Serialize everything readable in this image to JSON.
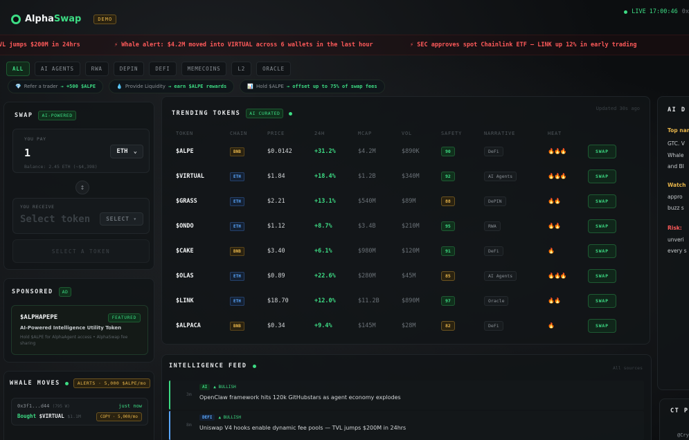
{
  "header": {
    "logo_alpha": "Alpha",
    "logo_swap": "Swap",
    "demo": "DEMO",
    "live": "LIVE 17:00:46",
    "live_extra": "0x"
  },
  "ticker": [
    "VL jumps $200M in 24hrs",
    "⚡ Whale alert: $4.2M moved into VIRTUAL across 6 wallets in the last hour",
    "⚡ SEC approves spot Chainlink ETF — LINK up 12% in early trading"
  ],
  "filters": [
    "ALL",
    "AI AGENTS",
    "RWA",
    "DEPIN",
    "DEFI",
    "MEMECOINS",
    "L2",
    "ORACLE"
  ],
  "promos": [
    {
      "icon": "💎",
      "text": "Refer a trader",
      "hl": "→ +500 $ALPE"
    },
    {
      "icon": "💧",
      "text": "Provide Liquidity",
      "hl": "→ earn $ALPE rewards"
    },
    {
      "icon": "📊",
      "text": "Hold $ALPE",
      "hl": "→ offset up to 75% of swap fees"
    }
  ],
  "swap": {
    "title": "SWAP",
    "tag": "AI-POWERED",
    "you_pay": "YOU PAY",
    "amount": "1",
    "token": "ETH",
    "balance": "Balance: 2.45 ETH (~$4,398)",
    "arrow": "↕",
    "you_receive": "YOU RECEIVE",
    "receive_placeholder": "Select token",
    "select": "SELECT ▾",
    "cta": "SELECT A TOKEN"
  },
  "sponsored": {
    "title": "SPONSORED",
    "ad": "AD",
    "name": "$ALPHAPEPE",
    "featured": "FEATURED",
    "sub": "AI-Powered Intelligence Utility Token",
    "desc": "Hold $ALPE for AlphaAgent access • AlphaSwap fee sharing"
  },
  "whale": {
    "title": "WHALE MOVES",
    "alert": "ALERTS · 5,000 $ALPE/mo",
    "addr": "0x3f1...d44",
    "addr_dim": "(795 W)",
    "time": "just now",
    "bought": "Bought",
    "token": "$VIRTUAL",
    "amount": "$1.1M",
    "copy": "COPY · 5,000/mo"
  },
  "trending": {
    "title": "TRENDING TOKENS",
    "tag": "AI CURATED",
    "updated": "Updated 30s ago",
    "columns": [
      "TOKEN",
      "CHAIN",
      "PRICE",
      "24H",
      "MCAP",
      "VOL",
      "SAFETY",
      "NARRATIVE",
      "HEAT",
      ""
    ],
    "rows": [
      {
        "token": "$ALPE",
        "chain": "BNB",
        "price": "$0.0142",
        "change": "+31.2%",
        "mcap": "$4.2M",
        "vol": "$890K",
        "safety": "90",
        "narrative": "DeFi",
        "heat": "🔥🔥🔥",
        "action": "SWAP"
      },
      {
        "token": "$VIRTUAL",
        "chain": "ETH",
        "price": "$1.84",
        "change": "+18.4%",
        "mcap": "$1.2B",
        "vol": "$340M",
        "safety": "92",
        "narrative": "AI Agents",
        "heat": "🔥🔥🔥",
        "action": "SWAP"
      },
      {
        "token": "$GRASS",
        "chain": "ETH",
        "price": "$2.21",
        "change": "+13.1%",
        "mcap": "$540M",
        "vol": "$89M",
        "safety": "88",
        "narrative": "DePIN",
        "heat": "🔥🔥",
        "action": "SWAP"
      },
      {
        "token": "$ONDO",
        "chain": "ETH",
        "price": "$1.12",
        "change": "+8.7%",
        "mcap": "$3.4B",
        "vol": "$210M",
        "safety": "95",
        "narrative": "RWA",
        "heat": "🔥🔥",
        "action": "SWAP"
      },
      {
        "token": "$CAKE",
        "chain": "BNB",
        "price": "$3.40",
        "change": "+6.1%",
        "mcap": "$980M",
        "vol": "$120M",
        "safety": "91",
        "narrative": "DeFi",
        "heat": "🔥",
        "action": "SWAP"
      },
      {
        "token": "$OLAS",
        "chain": "ETH",
        "price": "$0.89",
        "change": "+22.6%",
        "mcap": "$280M",
        "vol": "$45M",
        "safety": "85",
        "narrative": "AI Agents",
        "heat": "🔥🔥🔥",
        "action": "SWAP"
      },
      {
        "token": "$LINK",
        "chain": "ETH",
        "price": "$18.70",
        "change": "+12.0%",
        "mcap": "$11.2B",
        "vol": "$890M",
        "safety": "97",
        "narrative": "Oracle",
        "heat": "🔥🔥",
        "action": "SWAP"
      },
      {
        "token": "$ALPACA",
        "chain": "BNB",
        "price": "$0.34",
        "change": "+9.4%",
        "mcap": "$145M",
        "vol": "$28M",
        "safety": "82",
        "narrative": "DeFi",
        "heat": "🔥",
        "action": "SWAP"
      }
    ]
  },
  "feed": {
    "title": "INTELLIGENCE FEED",
    "all_sources": "All sources",
    "items": [
      {
        "time": "3m",
        "tag": "AI",
        "sentiment": "▲ BULLISH",
        "text": "OpenClaw framework hits 120k GitHubstars as agent economy explodes"
      },
      {
        "time": "8m",
        "tag": "DEFI",
        "sentiment": "▲ BULLISH",
        "text": "Uniswap V4 hooks enable dynamic fee pools — TVL jumps $200M in 24hrs"
      }
    ]
  },
  "ai_digest": {
    "title": "AI D",
    "lines": [
      {
        "text": "Top nam",
        "color": "#e7b54a"
      },
      {
        "text": "GTC. V",
        "color": "#c6cacd"
      },
      {
        "text": "Whale",
        "color": "#c6cacd"
      },
      {
        "text": "and BI",
        "color": "#c6cacd"
      },
      {
        "text": "Watch",
        "color": "#e7b54a"
      },
      {
        "text": "appro",
        "color": "#c6cacd"
      },
      {
        "text": "buzz s",
        "color": "#c6cacd"
      },
      {
        "text": "Risk:",
        "color": "#ff5a5a"
      },
      {
        "text": "unveri",
        "color": "#c6cacd"
      },
      {
        "text": "every s",
        "color": "#c6cacd"
      }
    ]
  },
  "ct": {
    "title": "CT P",
    "handle": "@Cry"
  }
}
